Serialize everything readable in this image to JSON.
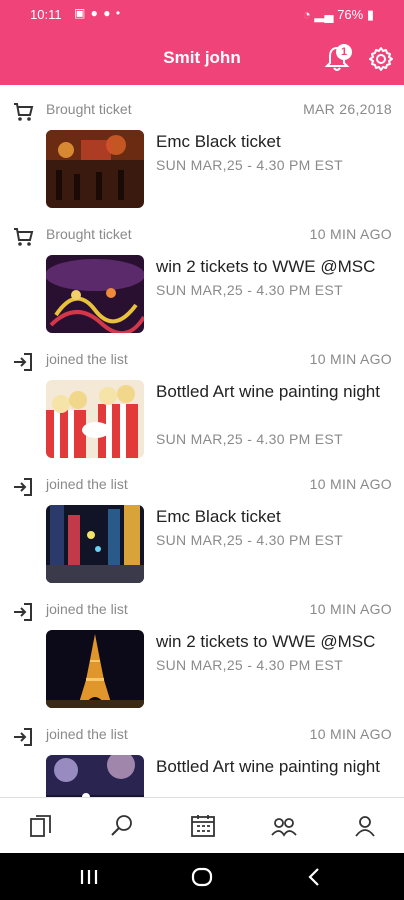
{
  "status_bar": {
    "time": "10:11",
    "battery": "76%"
  },
  "header": {
    "title": "Smit john",
    "notification_count": "1"
  },
  "feed": [
    {
      "action": "Brought ticket",
      "action_icon": "cart-icon",
      "time": "MAR 26,2018",
      "title": "Emc Black ticket",
      "date": "SUN MAR,25 - 4.30 PM EST",
      "image": "concert-crowd"
    },
    {
      "action": "Brought ticket",
      "action_icon": "cart-icon",
      "time": "10 MIN AGO",
      "title": "win 2 tickets to WWE @MSC",
      "date": "SUN MAR,25 - 4.30 PM EST",
      "image": "stage-dancers"
    },
    {
      "action": "joined the list",
      "action_icon": "join-icon",
      "time": "10 MIN AGO",
      "title": "Bottled Art wine painting night",
      "date": "SUN MAR,25 - 4.30 PM EST",
      "image": "popcorn"
    },
    {
      "action": "joined the list",
      "action_icon": "join-icon",
      "time": "10 MIN AGO",
      "title": "Emc Black ticket",
      "date": "SUN MAR,25 - 4.30 PM EST",
      "image": "city-street-night"
    },
    {
      "action": "joined the list",
      "action_icon": "join-icon",
      "time": "10 MIN AGO",
      "title": "win 2 tickets to WWE @MSC",
      "date": "SUN MAR,25 - 4.30 PM EST",
      "image": "eiffel-tower-night"
    },
    {
      "action": "joined the list",
      "action_icon": "join-icon",
      "time": "10 MIN AGO",
      "title": "Bottled Art wine painting night",
      "date": "",
      "image": "concert-lights"
    }
  ],
  "bottom_nav": [
    "feed-icon",
    "search-icon",
    "calendar-icon",
    "people-icon",
    "profile-icon"
  ],
  "colors": {
    "accent": "#f0437a",
    "text": "#222222",
    "muted": "#8a8a8a"
  }
}
